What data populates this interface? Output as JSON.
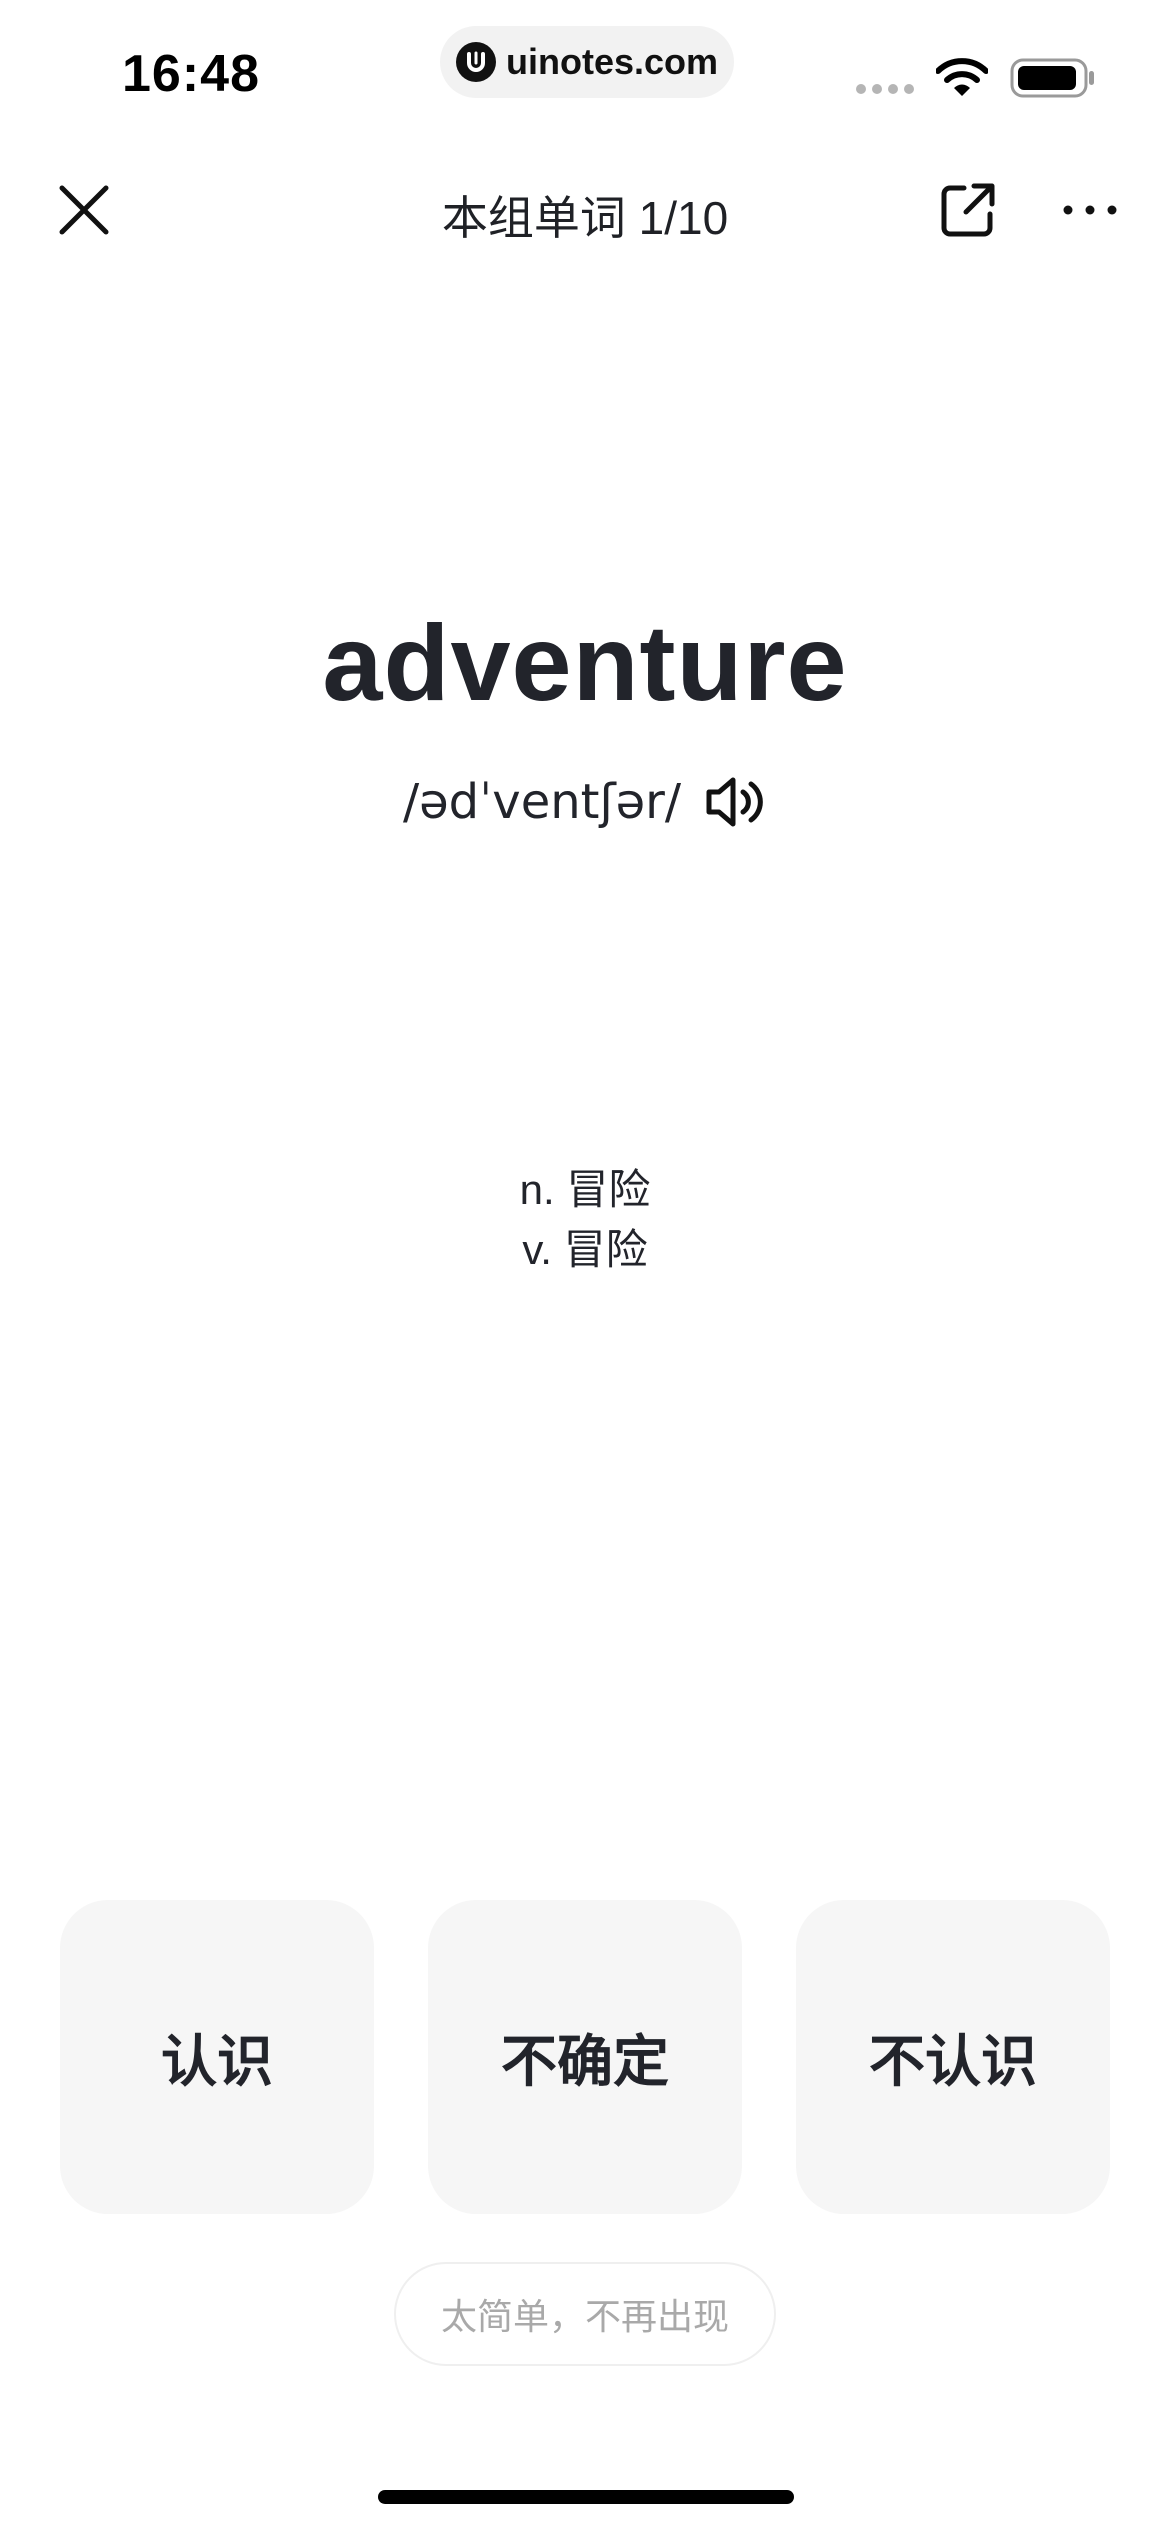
{
  "status_bar": {
    "time": "16:48",
    "url": "uinotes.com",
    "icons": [
      "cellular-signal-icon",
      "wifi-icon",
      "battery-icon"
    ]
  },
  "nav": {
    "close_icon": "close-icon",
    "title": "本组单词 1/10",
    "share_icon": "share-icon",
    "more_icon": "more-icon"
  },
  "card": {
    "word": "adventure",
    "phonetic": "/ədˈventʃər/",
    "speaker_icon": "speaker-icon",
    "definitions": [
      "n. 冒险",
      "v. 冒险"
    ]
  },
  "answers": {
    "know": "认识",
    "unsure": "不确定",
    "dont_know": "不认识"
  },
  "too_easy": "太简单，不再出现",
  "colors": {
    "text": "#22242b",
    "button_bg": "#f6f6f6",
    "muted": "#a9a9a9"
  }
}
